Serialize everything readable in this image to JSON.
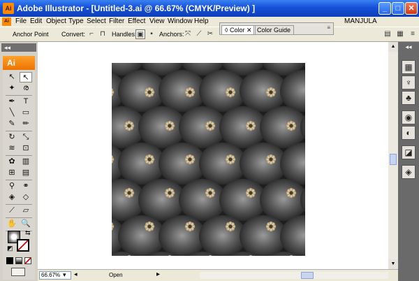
{
  "window": {
    "app_icon": "Ai",
    "title": "Adobe Illustrator - [Untitled-3.ai @ 66.67% (CMYK/Preview) ]",
    "minimize": "_",
    "maximize": "□",
    "close": "✕"
  },
  "menubar": {
    "app_icon": "Ai",
    "items": [
      "File",
      "Edit",
      "Object",
      "Type",
      "Select",
      "Filter",
      "Effect",
      "View",
      "Window",
      "Help"
    ],
    "user": "MANJULA"
  },
  "control_bar": {
    "tool_label": "Anchor Point",
    "convert_label": "Convert:",
    "handles_label": "Handles:",
    "anchors_label": "Anchors:"
  },
  "color_panel": {
    "tabs": [
      {
        "label": "◊ Color ✕",
        "active": true
      },
      {
        "label": "Color Guide",
        "active": false
      }
    ],
    "menu_icon": "≡"
  },
  "tools_panel": {
    "collapse": "◂◂",
    "badge": "Ai",
    "tools": [
      {
        "name": "selection-tool",
        "glyph": "↖"
      },
      {
        "name": "direct-selection-tool",
        "glyph": "↖"
      },
      {
        "name": "magic-wand-tool",
        "glyph": "✦"
      },
      {
        "name": "lasso-tool",
        "glyph": "ര"
      },
      {
        "name": "pen-tool",
        "glyph": "✒"
      },
      {
        "name": "type-tool",
        "glyph": "T"
      },
      {
        "name": "line-segment-tool",
        "glyph": "╲"
      },
      {
        "name": "rectangle-tool",
        "glyph": "▭"
      },
      {
        "name": "paintbrush-tool",
        "glyph": "✎"
      },
      {
        "name": "pencil-tool",
        "glyph": "✏"
      },
      {
        "name": "rotate-tool",
        "glyph": "↻"
      },
      {
        "name": "scale-tool",
        "glyph": "⤡"
      },
      {
        "name": "warp-tool",
        "glyph": "≋"
      },
      {
        "name": "free-transform-tool",
        "glyph": "⊡"
      },
      {
        "name": "symbol-sprayer-tool",
        "glyph": "✿"
      },
      {
        "name": "column-graph-tool",
        "glyph": "▥"
      },
      {
        "name": "mesh-tool",
        "glyph": "⊞"
      },
      {
        "name": "gradient-tool",
        "glyph": "▤"
      },
      {
        "name": "eyedropper-tool",
        "glyph": "⚲"
      },
      {
        "name": "blend-tool",
        "glyph": "⚭"
      },
      {
        "name": "live-paint-bucket-tool",
        "glyph": "◈"
      },
      {
        "name": "live-paint-selection-tool",
        "glyph": "◇"
      },
      {
        "name": "slice-tool",
        "glyph": "⟋"
      },
      {
        "name": "eraser-tool",
        "glyph": "▱"
      },
      {
        "name": "hand-tool",
        "glyph": "✋"
      },
      {
        "name": "zoom-tool",
        "glyph": "🔍"
      }
    ],
    "swap": "⇆",
    "default": "◩"
  },
  "status_bar": {
    "zoom": "66.67%",
    "zoom_dropdown": "▾",
    "status": "Open",
    "status_arrow": "▸"
  },
  "right_dock": {
    "collapse": "◂◂",
    "buttons": [
      {
        "name": "swatches-panel-icon",
        "glyph": "▦"
      },
      {
        "name": "brushes-panel-icon",
        "glyph": "♆"
      },
      {
        "name": "symbols-panel-icon",
        "glyph": "♣"
      },
      {
        "name": "stroke-panel-icon",
        "glyph": "◉"
      },
      {
        "name": "appearance-panel-icon",
        "glyph": "◐"
      },
      {
        "name": "graphic-styles-panel-icon",
        "glyph": "◪"
      },
      {
        "name": "layers-panel-icon",
        "glyph": "◈"
      }
    ]
  },
  "colors": {
    "titlebar": "#1650d8",
    "ai_orange": "#ff8a00",
    "artwork_dark": "#2b2b2b",
    "button_beige": "#d8c8a0"
  }
}
